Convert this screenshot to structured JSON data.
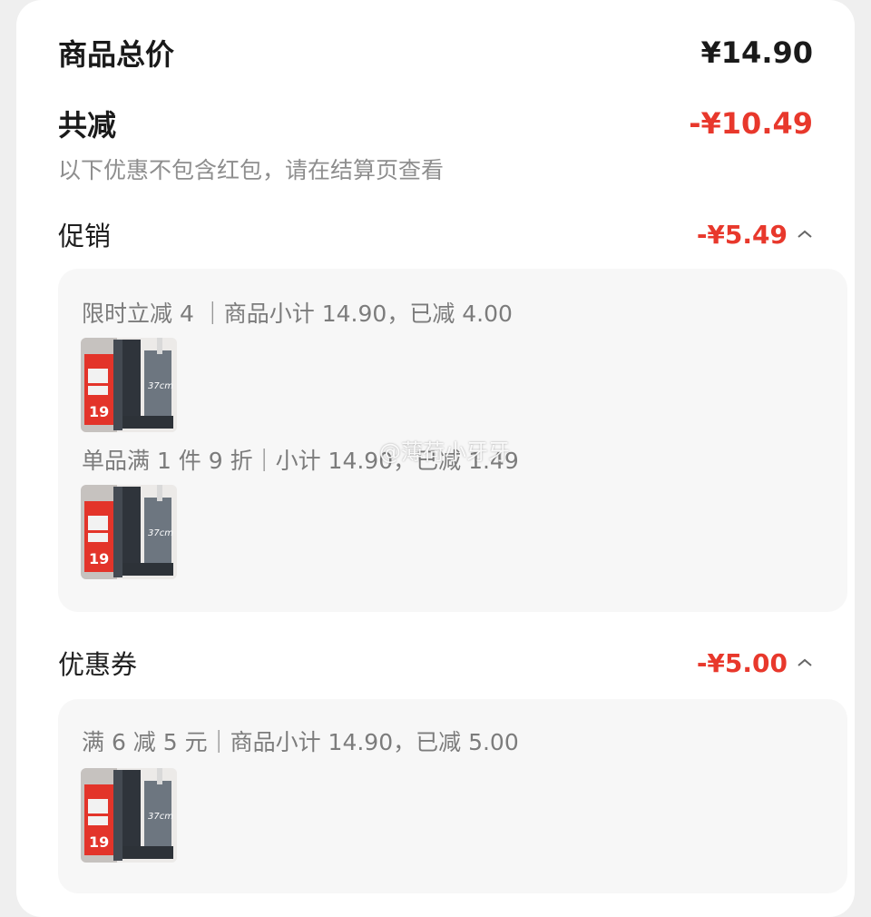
{
  "summary": {
    "total_label": "商品总价",
    "total_value": "¥14.90",
    "reduce_label": "共减",
    "reduce_value": "-¥10.49",
    "note": "以下优惠不包含红包，请在结算页查看"
  },
  "promo": {
    "label": "促销",
    "value": "-¥5.49",
    "items": [
      {
        "text": "限时立减 4 ｜商品小计 14.90，已减 4.00",
        "image": {
          "badge": "19",
          "size_tag": "37cm"
        }
      },
      {
        "text": "单品满 1 件 9 折｜小计 14.90，已减 1.49",
        "image": {
          "badge": "19",
          "size_tag": "37cm"
        }
      }
    ]
  },
  "coupon": {
    "label": "优惠券",
    "value": "-¥5.00",
    "items": [
      {
        "text": "满 6 减 5 元｜商品小计 14.90，已减 5.00",
        "image": {
          "badge": "19",
          "size_tag": "37cm"
        }
      }
    ]
  },
  "watermark": "@薄荷小牙牙",
  "colors": {
    "accent_red": "#e8382c",
    "muted_text": "#7c7c7c",
    "panel_bg": "#f7f7f7",
    "page_bg": "#efefef"
  },
  "icons": {
    "collapse": "chevron-up-icon",
    "product": "mop-product-thumbnail"
  }
}
